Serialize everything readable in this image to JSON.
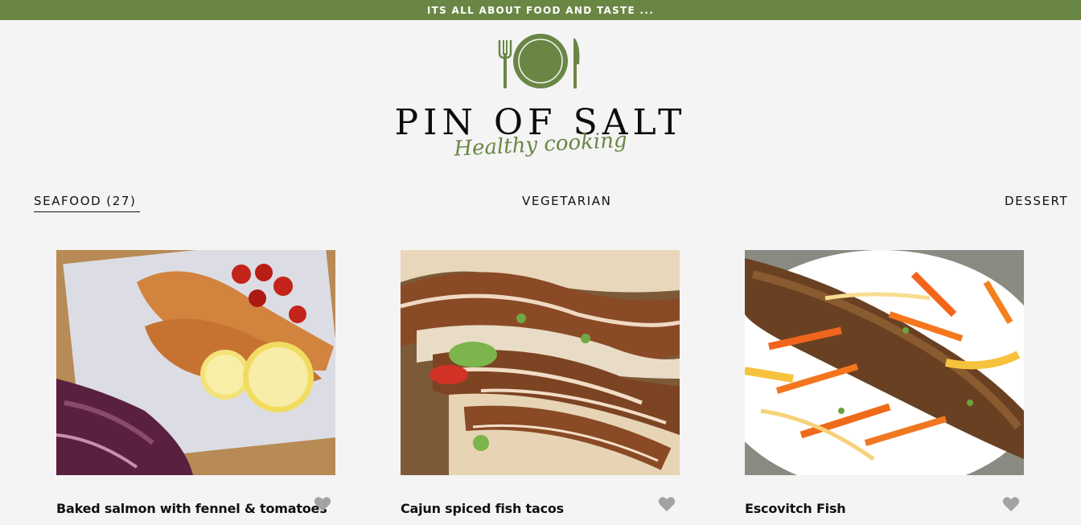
{
  "topbar": {
    "tagline": "ITS ALL ABOUT FOOD AND TASTE ..."
  },
  "brand": {
    "logo_icon": "plate-fork-knife-icon",
    "title": "PIN OF SALT",
    "subtitle": "Healthy cooking",
    "accent_color": "#6a8645"
  },
  "nav": {
    "seafood_label": "SEAFOOD",
    "seafood_count": "(27)",
    "vegetarian_label": "VEGETARIAN",
    "dessert_label": "DESSERT"
  },
  "recipes": [
    {
      "title": "Baked salmon with fennel & tomatoes",
      "icon": "heart-icon"
    },
    {
      "title": "Cajun spiced fish tacos",
      "icon": "heart-icon"
    },
    {
      "title": "Escovitch Fish",
      "icon": "heart-icon"
    }
  ]
}
